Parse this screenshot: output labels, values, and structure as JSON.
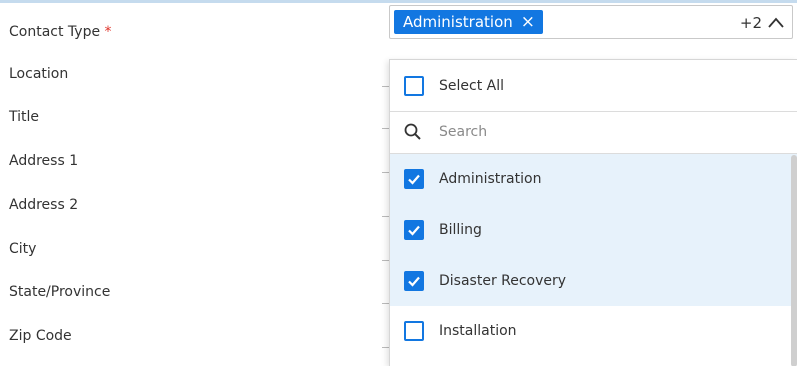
{
  "form": {
    "fields": [
      {
        "label": "Contact Type",
        "required": true,
        "required_mark": "*"
      },
      {
        "label": "Location"
      },
      {
        "label": "Title"
      },
      {
        "label": "Address 1"
      },
      {
        "label": "Address 2"
      },
      {
        "label": "City"
      },
      {
        "label": "State/Province"
      },
      {
        "label": "Zip Code"
      }
    ]
  },
  "multiselect": {
    "chip_label": "Administration",
    "chip_close_glyph": "×",
    "more_count": "+2",
    "expanded": true
  },
  "dropdown": {
    "select_all_label": "Select All",
    "search_placeholder": "Search",
    "options": [
      {
        "label": "Administration",
        "checked": true
      },
      {
        "label": "Billing",
        "checked": true
      },
      {
        "label": "Disaster Recovery",
        "checked": true
      },
      {
        "label": "Installation",
        "checked": false
      }
    ]
  },
  "colors": {
    "accent": "#1277e1",
    "selected_row_bg": "#e7f2fb",
    "required": "#e0352b"
  },
  "icons": {
    "chevron": "chevron-up-icon",
    "search": "search-icon",
    "check": "check-icon",
    "close": "close-icon"
  }
}
